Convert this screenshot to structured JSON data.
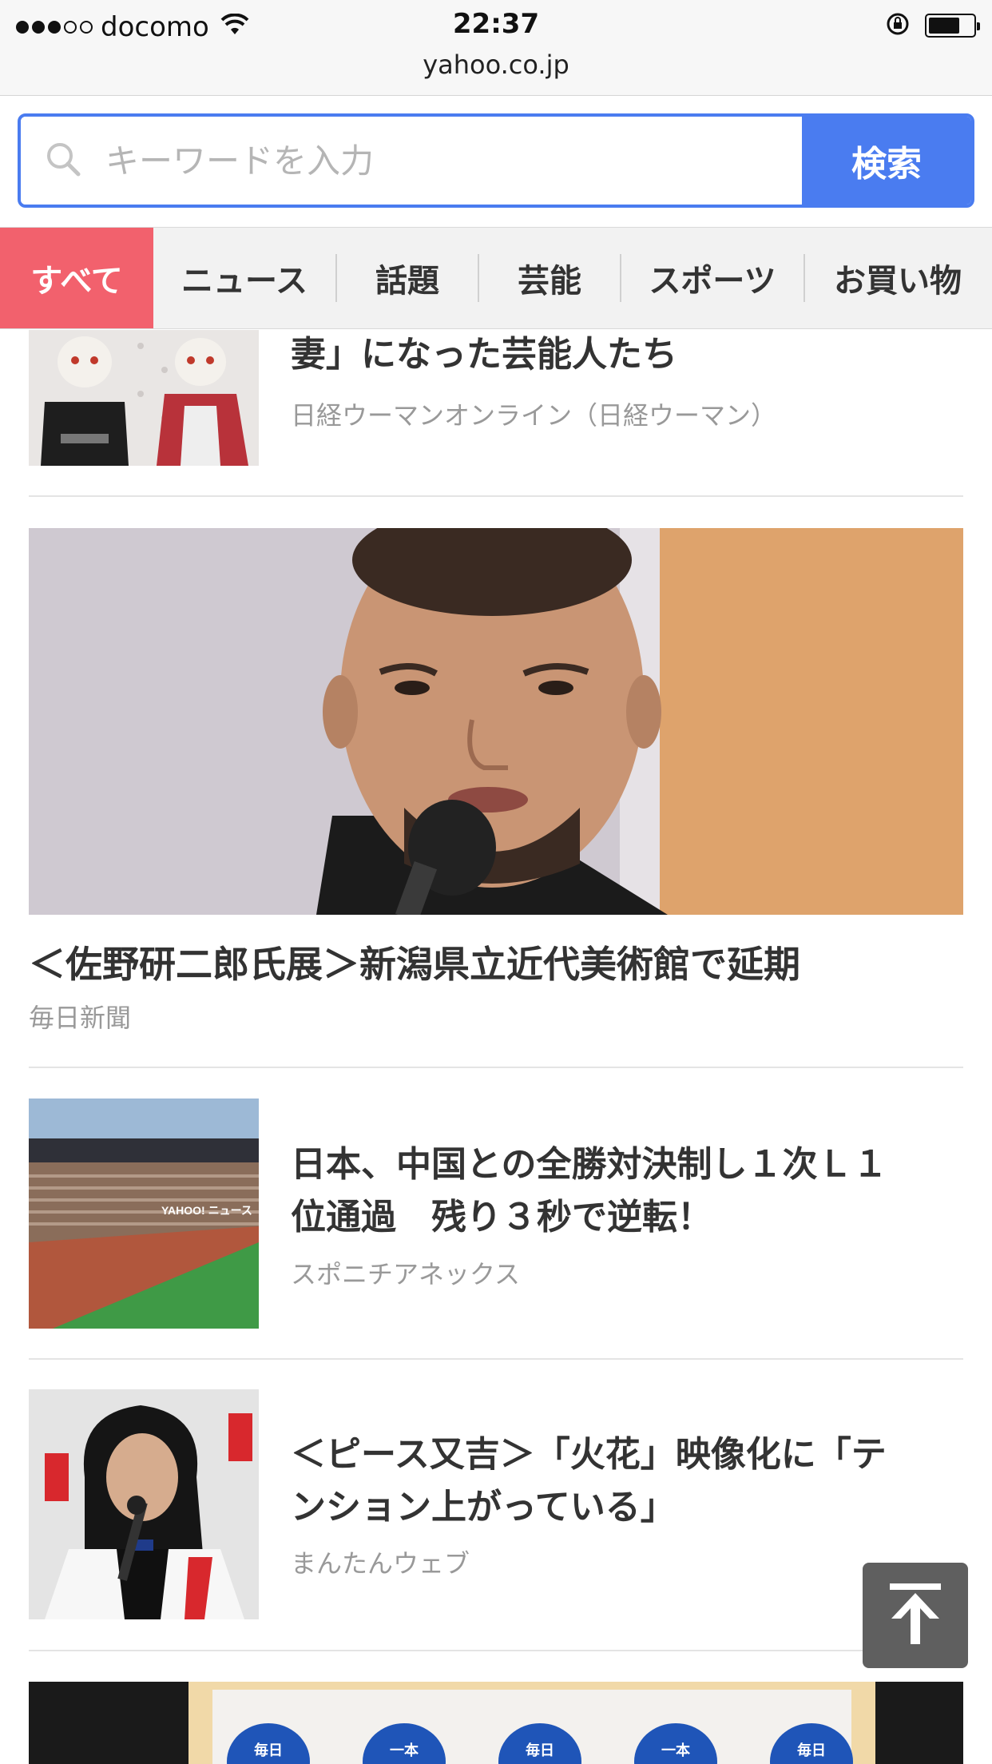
{
  "status_bar": {
    "carrier": "docomo",
    "time": "22:37",
    "url": "yahoo.co.jp",
    "signal_bars": 3,
    "battery_level": 0.7
  },
  "search": {
    "placeholder": "キーワードを入力",
    "button_label": "検索"
  },
  "tabs": [
    {
      "label": "すべて",
      "active": true
    },
    {
      "label": "ニュース",
      "active": false
    },
    {
      "label": "話題",
      "active": false
    },
    {
      "label": "芸能",
      "active": false
    },
    {
      "label": "スポーツ",
      "active": false
    },
    {
      "label": "お買い物",
      "active": false
    }
  ],
  "articles": [
    {
      "title_line1": "妻」になった芸能人たち",
      "source": "日経ウーマンオンライン（日経ウーマン）",
      "thumb": "dolls-photo"
    },
    {
      "title": "＜佐野研二郎氏展＞新潟県立近代美術館で延期",
      "source": "毎日新聞",
      "thumb": "press-conference-photo"
    },
    {
      "title_line1": "日本、中国との全勝対決制し１次Ｌ１",
      "title_line2": "位通過　残り３秒で逆転！",
      "source": "スポニチアネックス",
      "thumb": "stadium-photo",
      "thumb_text": "YAHOO! ニュース"
    },
    {
      "title_line1": "＜ピース又吉＞「火花」映像化に「テ",
      "title_line2": "ンション上がっている」",
      "source": "まんたんウェブ",
      "thumb": "comedian-photo"
    }
  ],
  "bottom_image_labels": [
    "毎日",
    "一本",
    "毎日",
    "一本",
    "毎日"
  ],
  "colors": {
    "accent": "#4a7cf0",
    "active_tab": "#f2616d",
    "source_text": "#999999"
  }
}
